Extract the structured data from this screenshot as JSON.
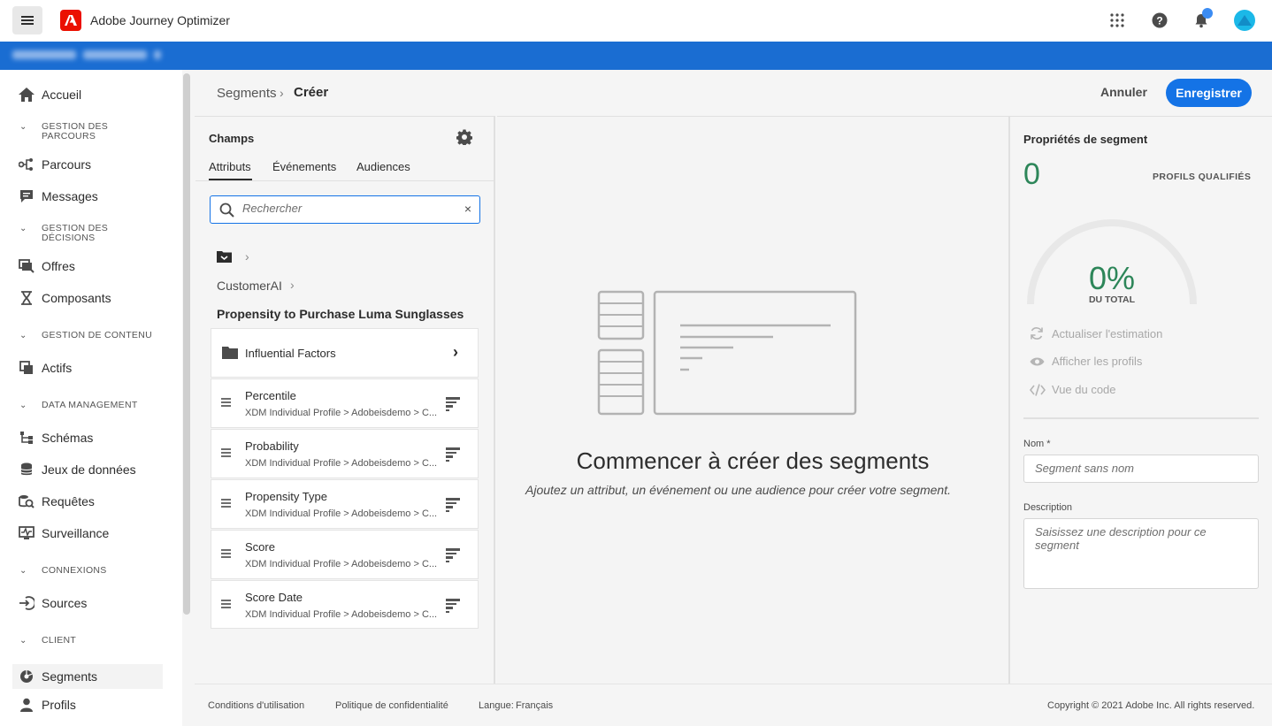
{
  "app": {
    "title": "Adobe Journey Optimizer"
  },
  "sidebar": {
    "home": "Accueil",
    "sections": {
      "journeys": [
        "GESTION DES",
        "PARCOURS"
      ],
      "decisions": [
        "GESTION DES",
        "DÉCISIONS"
      ],
      "content": "GESTION DE CONTENU",
      "data": "DATA MANAGEMENT",
      "connections": "CONNEXIONS",
      "client": "CLIENT"
    },
    "items": {
      "journeys": "Parcours",
      "messages": "Messages",
      "offers": "Offres",
      "components": "Composants",
      "assets": "Actifs",
      "schemas": "Schémas",
      "datasets": "Jeux de données",
      "queries": "Requêtes",
      "monitoring": "Surveillance",
      "sources": "Sources",
      "segments": "Segments",
      "profiles": "Profils"
    }
  },
  "breadcrumb": {
    "parent": "Segments",
    "current": "Créer"
  },
  "header": {
    "cancel": "Annuler",
    "save": "Enregistrer"
  },
  "fields": {
    "title": "Champs",
    "tabs": [
      "Attributs",
      "Événements",
      "Audiences"
    ],
    "search_placeholder": "Rechercher",
    "path": "CustomerAI",
    "group_title": "Propensity to Purchase Luma Sunglasses",
    "folder": "Influential Factors",
    "attributes": [
      {
        "label": "Percentile",
        "path": "XDM Individual Profile > Adobeisdemo > C..."
      },
      {
        "label": "Probability",
        "path": "XDM Individual Profile > Adobeisdemo > C..."
      },
      {
        "label": "Propensity Type",
        "path": "XDM Individual Profile > Adobeisdemo > C..."
      },
      {
        "label": "Score",
        "path": "XDM Individual Profile > Adobeisdemo > C..."
      },
      {
        "label": "Score Date",
        "path": "XDM Individual Profile > Adobeisdemo > C..."
      }
    ]
  },
  "canvas": {
    "heading": "Commencer à créer des segments",
    "subheading": "Ajoutez un attribut, un événement ou une audience pour créer votre segment."
  },
  "properties": {
    "title": "Propriétés de segment",
    "count": "0",
    "count_label": "PROFILS QUALIFIÉS",
    "percent": "0%",
    "percent_label": "DU TOTAL",
    "percent_value": 0,
    "actions": [
      "Actualiser l'estimation",
      "Afficher les profils",
      "Vue du code"
    ],
    "name_label": "Nom *",
    "name_placeholder": "Segment sans nom",
    "desc_label": "Description",
    "desc_placeholder": "Saisissez une description pour ce segment"
  },
  "footer": {
    "terms": "Conditions d'utilisation",
    "privacy": "Politique de confidentialité",
    "language_label": "Langue:",
    "language": "Français",
    "copyright": "Copyright © 2021 Adobe Inc. All rights reserved."
  },
  "colors": {
    "accent": "#1473e6",
    "orgbar": "#1a6dd2",
    "count_green": "#2d8659"
  }
}
